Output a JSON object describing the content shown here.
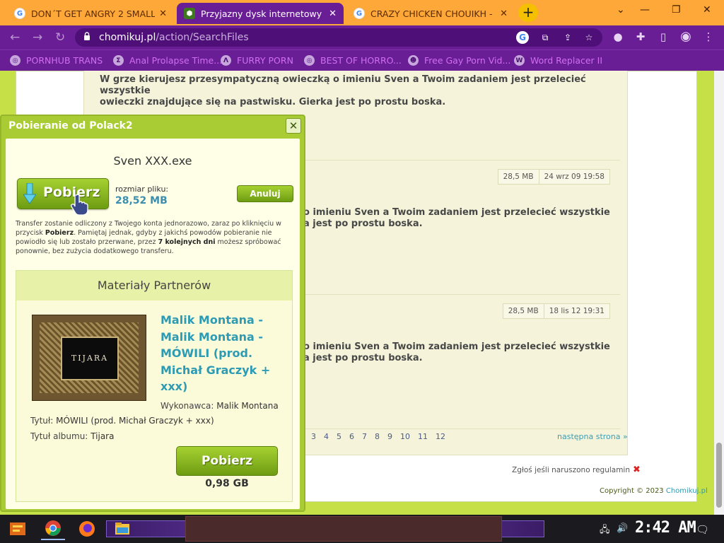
{
  "browser": {
    "tabs": [
      {
        "title": "DON´T GET ANGRY 2 SMALL",
        "favicon": "google-icon"
      },
      {
        "title": "Przyjazny dysk internetowy - C",
        "favicon": "chomikuj-icon",
        "active": true
      },
      {
        "title": "CRAZY CHICKEN CHOUIKH - C",
        "favicon": "google-icon"
      }
    ],
    "new_tab": "+",
    "url_host": "chomikuj.pl",
    "url_path": "/action/SearchFiles",
    "bookmarks": [
      {
        "label": "PORNHUB TRANS",
        "icon": "globe-icon"
      },
      {
        "label": "Anal Prolapse Time...",
        "icon": "bookmark-icon"
      },
      {
        "label": "FURRY PORN",
        "icon": "bookmark-icon"
      },
      {
        "label": "BEST OF HORRO...",
        "icon": "globe-icon"
      },
      {
        "label": "Free Gay Porn Vid...",
        "icon": "bookmark-icon"
      },
      {
        "label": "Word Replacer II",
        "icon": "extension-icon"
      }
    ]
  },
  "results": {
    "description_line1": "W grze kierujesz przesympatyczną owieczką o imieniu Sven a Twoim zadaniem jest przelecieć wszystkie",
    "description_line2": "owieczki znajdujące się na pastwisku. Gierka jest po prostu boska.",
    "partial_line1": "o imieniu Sven a Twoim zadaniem jest przelecieć wszystkie",
    "partial_line2": "a jest po prostu boska.",
    "items": [
      {
        "size": "28,5 MB",
        "date": "24 wrz 09 19:58"
      },
      {
        "size": "28,5 MB",
        "date": "18 lis 12 19:31"
      }
    ],
    "pages": [
      "3",
      "4",
      "5",
      "6",
      "7",
      "8",
      "9",
      "10",
      "11",
      "12"
    ],
    "next_page": "następna strona »",
    "report": "Zgłoś jeśli naruszono regulamin",
    "copyright_prefix": "Copyright © 2023",
    "copyright_link": "Chomikuj.pl"
  },
  "dialog": {
    "title": "Pobieranie od Polack2",
    "filename": "Sven XXX.exe",
    "download_label": "Pobierz",
    "file_size_label": "rozmiar pliku:",
    "file_size_value": "28,52 MB",
    "cancel_label": "Anuluj",
    "info_text_1": "Transfer zostanie odliczony z Twojego konta jednorazowo, zaraz po kliknięciu w przycisk ",
    "info_bold_1": "Pobierz",
    "info_text_2": ". Pamiętaj jednak, gdyby z jakichś powodów pobieranie nie powiodło się lub zostało przerwane, przez ",
    "info_bold_2": "7 kolejnych dni",
    "info_text_3": " możesz spróbować ponownie, bez zużycia dodatkowego transferu.",
    "partners": {
      "header": "Materiały Partnerów",
      "album_text": "TIJARA",
      "track_title": "Malik Montana - Malik Montana - MÓWILI (prod. Michał Graczyk + xxx)",
      "artist_label": "Wykonawca:",
      "artist_value": "Malik Montana",
      "title_label": "Tytuł:",
      "title_value": "MÓWILI (prod. Michał Graczyk + xxx)",
      "album_label": "Tytuł albumu:",
      "album_value": "Tijara",
      "download_label": "Pobierz",
      "download_size": "0,98 GB"
    }
  },
  "taskbar": {
    "clock": "2:42 AM"
  },
  "colors": {
    "page_bg": "#c6e048",
    "accent_green": "#8bb521",
    "link_blue": "#2c9bb3",
    "chrome_purple": "#6a1e96",
    "tabbar_orange": "#ffa83a"
  }
}
